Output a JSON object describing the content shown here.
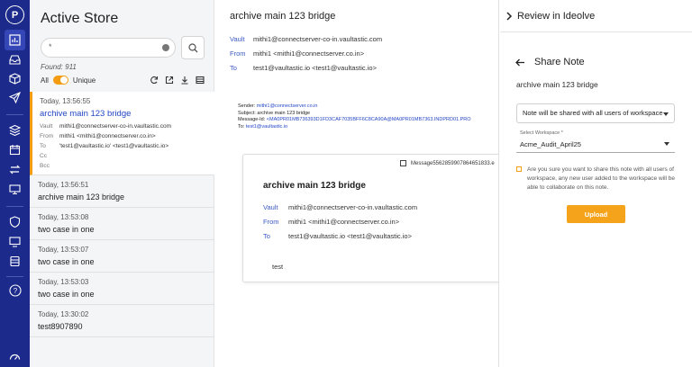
{
  "rail": {
    "logo_letter": "P",
    "icons": [
      "chart-icon",
      "inbox-icon",
      "box-icon",
      "send-icon",
      "layers-icon",
      "calendar-icon",
      "transfer-icon",
      "monitor-icon",
      "shield-icon",
      "desktop-icon",
      "database-icon",
      "help-icon",
      "gauge-icon"
    ]
  },
  "list": {
    "title": "Active Store",
    "search_value": "*",
    "found": "Found: 911",
    "filter_all": "All",
    "filter_unique": "Unique",
    "items": [
      {
        "time": "Today, 13:56:55",
        "subject": "archive main 123 bridge",
        "meta": [
          {
            "k": "Vault",
            "v": "mithi1@connectserver-co-in.vaultastic.com"
          },
          {
            "k": "From",
            "v": "mithi1 <mithi1@connectserver.co.in>"
          },
          {
            "k": "To",
            "v": "'test1@vaultastic.io' <test1@vaultastic.io>"
          },
          {
            "k": "Cc",
            "v": ""
          },
          {
            "k": "Bcc",
            "v": ""
          }
        ]
      },
      {
        "time": "Today, 13:56:51",
        "subject": "archive main 123 bridge"
      },
      {
        "time": "Today, 13:53:08",
        "subject": "two case in one"
      },
      {
        "time": "Today, 13:53:07",
        "subject": "two case in one"
      },
      {
        "time": "Today, 13:53:03",
        "subject": "two case in one"
      },
      {
        "time": "Today, 13:30:02",
        "subject": "test8907890"
      }
    ]
  },
  "message": {
    "subject": "archive main 123 bridge",
    "vault_label": "Vault",
    "vault": "mithi1@connectserver-co-in.vaultastic.com",
    "from_label": "From",
    "from": "mithi1 <mithi1@connectserver.co.in>",
    "to_label": "To",
    "to": "test1@vaultastic.io <test1@vaultastic.io>",
    "raw": {
      "sender_label": "Sender:",
      "sender": "mithi1@connectserver.co.in",
      "subject_line": "Subject: archive main 123 bridge",
      "msgid_label": "Message-Id:",
      "msgid": "<MA0PR01MB736393D1FD3CAF7035BFF6C8CA90A@MA0PR01MB7363.INDPRD01.PRO",
      "to_label": "To:",
      "to": "test1@vaultastic.io"
    },
    "card": {
      "attachment": "Message5562859907864651833.e",
      "title": "archive main 123 bridge",
      "vault": "mithi1@connectserver-co-in.vaultastic.com",
      "from": "mithi1 <mithi1@connectserver.co.in>",
      "to": "test1@vaultastic.io <test1@vaultastic.io>",
      "body": "test"
    }
  },
  "review": {
    "title": "Review in Ideolve",
    "share_title": "Share Note",
    "note_title": "archive main 123 bridge",
    "share_option": "Note will be shared with all users of workspace",
    "workspace_label": "Select Workspace *",
    "workspace_value": "Acme_Audit_April25",
    "confirm_text": "Are you sure you want to share this note with all users of workspace, any new user added to the workspace will be able to collaborate on this note.",
    "upload_label": "Upload"
  },
  "colors": {
    "rail": "#1c2a8c",
    "accent": "#f39c12",
    "link": "#2346c6"
  }
}
